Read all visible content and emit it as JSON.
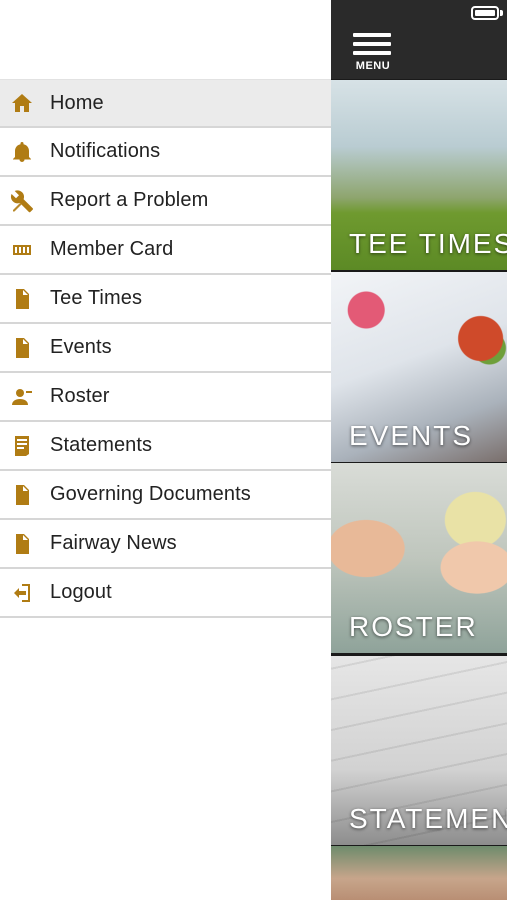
{
  "statusbar": {
    "battery_icon": "battery-full-icon"
  },
  "header": {
    "menu_label": "MENU",
    "menu_icon": "hamburger-icon"
  },
  "drawer": {
    "items": [
      {
        "label": "Home",
        "icon": "home-icon",
        "active": true
      },
      {
        "label": "Notifications",
        "icon": "bell-icon",
        "active": false
      },
      {
        "label": "Report a Problem",
        "icon": "tools-icon",
        "active": false
      },
      {
        "label": "Member Card",
        "icon": "card-icon",
        "active": false
      },
      {
        "label": "Tee Times",
        "icon": "document-icon",
        "active": false
      },
      {
        "label": "Events",
        "icon": "document-icon",
        "active": false
      },
      {
        "label": "Roster",
        "icon": "person-icon",
        "active": false
      },
      {
        "label": "Statements",
        "icon": "statement-icon",
        "active": false
      },
      {
        "label": "Governing Documents",
        "icon": "document-icon",
        "active": false
      },
      {
        "label": "Fairway News",
        "icon": "document-icon",
        "active": false
      },
      {
        "label": "Logout",
        "icon": "logout-icon",
        "active": false
      }
    ]
  },
  "tiles": [
    {
      "label": "TEE TIMES"
    },
    {
      "label": "EVENTS"
    },
    {
      "label": "ROSTER"
    },
    {
      "label": "STATEMENTS"
    }
  ],
  "colors": {
    "icon_gold": "#b07c14",
    "active_row": "#ebebeb",
    "topbar": "#2a2a2a"
  }
}
